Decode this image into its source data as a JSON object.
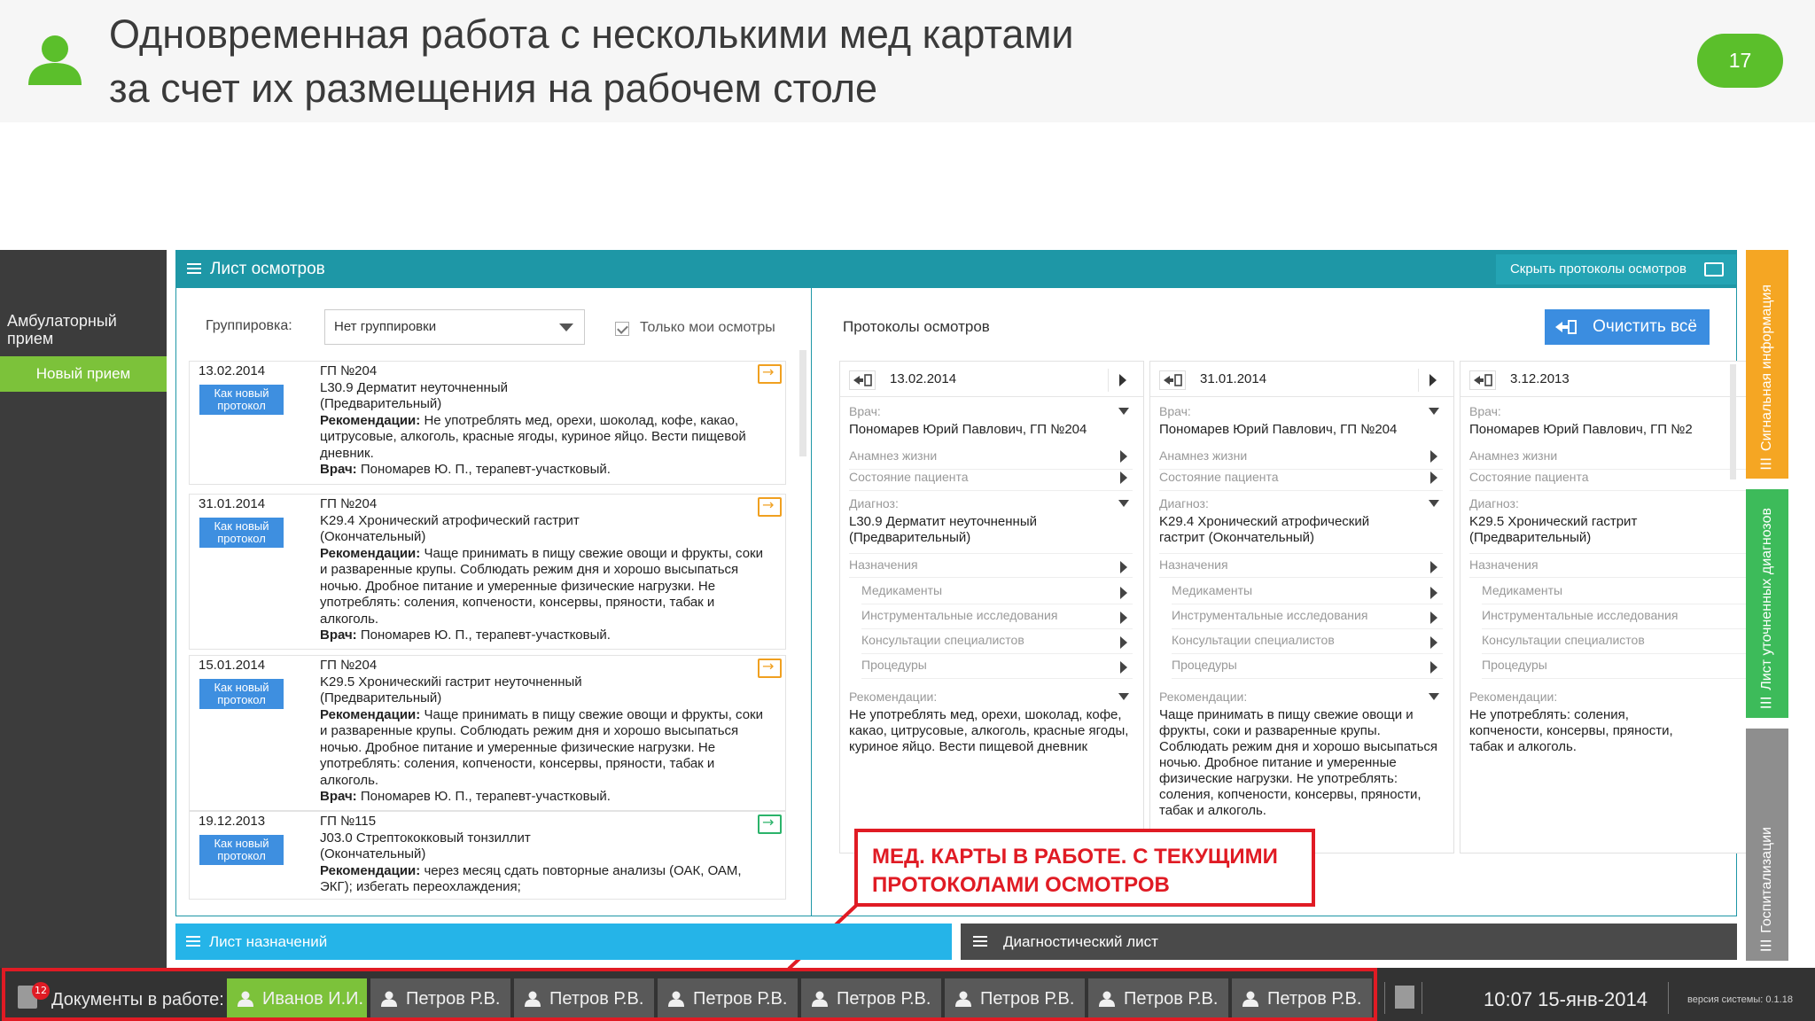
{
  "slide": {
    "title_line1": "Одновременная работа с несколькими мед картами",
    "title_line2": "за счет их размещения на рабочем столе",
    "number": "17"
  },
  "sidebar": {
    "ambulatory": "Амбулаторный прием",
    "new_visit": "Новый прием"
  },
  "panel": {
    "title": "Лист осмотров",
    "hide_protocols": "Скрыть протоколы осмотров"
  },
  "filter": {
    "grouping_label": "Группировка:",
    "grouping_value": "Нет группировки",
    "only_mine": "Только мои осмотры"
  },
  "exams": [
    {
      "date": "13.02.2014",
      "btn": "Как новый протокол",
      "gp": "ГП №204",
      "diagnosis": "L30.9 Дерматит неуточненный",
      "status": "(Предварительный)",
      "rec_label": "Рекомендации:",
      "rec": "Не употреблять мед, орехи, шоколад, кофе, какао, цитрусовые, алкоголь, красные ягоды, куриное яйцо. Вести пищевой дневник.",
      "doc_label": "Врач:",
      "doc": "Пономарев Ю. П., терапевт-участковый."
    },
    {
      "date": "31.01.2014",
      "btn": "Как новый протокол",
      "gp": "ГП №204",
      "diagnosis": "K29.4 Хронический атрофический гастрит",
      "status": "(Окончательный)",
      "rec_label": "Рекомендации:",
      "rec": "Чаще принимать в пищу свежие овощи и фрукты, соки и разваренные крупы. Соблюдать режим дня и хорошо высыпаться ночью. Дробное питание и умеренные физические нагрузки. Не употреблять: соления, копчености, консервы, пряности, табак и алкоголь.",
      "doc_label": "Врач:",
      "doc": "Пономарев Ю. П., терапевт-участковый."
    },
    {
      "date": "15.01.2014",
      "btn": "Как новый протокол",
      "gp": "ГП №204",
      "diagnosis": "K29.5 Хроническийі гастрит неуточненный",
      "status": "(Предварительный)",
      "rec_label": "Рекомендации:",
      "rec": "Чаще принимать в пищу свежие овощи и фрукты, соки и разваренные крупы. Соблюдать режим дня и хорошо высыпаться ночью. Дробное питание и умеренные физические нагрузки. Не употреблять: соления, копчености, консервы, пряности, табак и алкоголь.",
      "doc_label": "Врач:",
      "doc": "Пономарев Ю. П., терапевт-участковый."
    },
    {
      "date": "19.12.2013",
      "btn": "Как новый протокол",
      "gp": "ГП №115",
      "diagnosis": "J03.0 Стрептококковый тонзиллит",
      "status": "(Окончательный)",
      "rec_label": "Рекомендации:",
      "rec": "через месяц сдать повторные анализы (ОАК, ОАМ, ЭКГ); избегать переохлаждения;",
      "doc_label": "",
      "doc": ""
    }
  ],
  "protocols": {
    "label": "Протоколы осмотров",
    "clear_all": "Очистить всё",
    "fields": {
      "doctor": "Врач:",
      "anamnesis": "Анамнез жизни",
      "state": "Состояние пациента",
      "diagnosis": "Диагноз:",
      "assignments": "Назначения",
      "meds": "Медикаменты",
      "instrumental": "Инструментальные исследования",
      "consult": "Консультации специалистов",
      "procedures": "Процедуры",
      "recommendations": "Рекомендации:"
    },
    "columns": [
      {
        "date": "13.02.2014",
        "doctor": "Пономарев Юрий Павлович, ГП №204",
        "diagnosis": "L30.9 Дерматит неуточненный (Предварительный)",
        "recommendations": "Не употреблять мед, орехи, шоколад, кофе, какао, цитрусовые, алкоголь, красные ягоды, куриное яйцо. Вести пищевой дневник"
      },
      {
        "date": "31.01.2014",
        "doctor": "Пономарев Юрий Павлович, ГП №204",
        "diagnosis": "K29.4 Хронический атрофический гастрит (Окончательный)",
        "recommendations": "Чаще принимать в пищу свежие овощи и фрукты, соки и разваренные крупы. Соблюдать режим дня и хорошо высыпаться ночью. Дробное питание и умеренные физические нагрузки. Не употреблять: соления, копчености, консервы, пряности, табак и алкоголь."
      },
      {
        "date": "3.12.2013",
        "doctor": "Пономарев Юрий Павлович, ГП №2",
        "diagnosis": "K29.5 Хронический гастрит (Предварительный)",
        "recommendations": "Не употреблять: соления, копчености, консервы, пряности, табак и алкоголь."
      }
    ]
  },
  "annotation": {
    "line1": "МЕД. КАРТЫ В РАБОТЕ. С ТЕКУЩИМИ",
    "line2": "ПРОТОКОЛАМИ ОСМОТРОВ"
  },
  "bottom": {
    "assignments": "Лист назначений",
    "diagnostic": "Диагностический лист"
  },
  "right_tabs": {
    "signal": "Сигнальная информация",
    "diagnoses": "Лист уточненных диагнозов",
    "hospital": "Госпитализации"
  },
  "taskbar": {
    "badge": "12",
    "docs_label": "Документы в работе:",
    "tabs": [
      "Иванов И.И.",
      "Петров Р.В.",
      "Петров Р.В.",
      "Петров Р.В.",
      "Петров Р.В.",
      "Петров Р.В.",
      "Петров Р.В.",
      "Петров Р.В."
    ],
    "clock": "10:07 15-янв-2014",
    "version": "версия системы: 0.1.18"
  },
  "colors": {
    "teal": "#1e97a6",
    "green": "#7cc23a",
    "blue": "#3b8de0",
    "red": "#e01b24",
    "orange": "#f5a623"
  }
}
